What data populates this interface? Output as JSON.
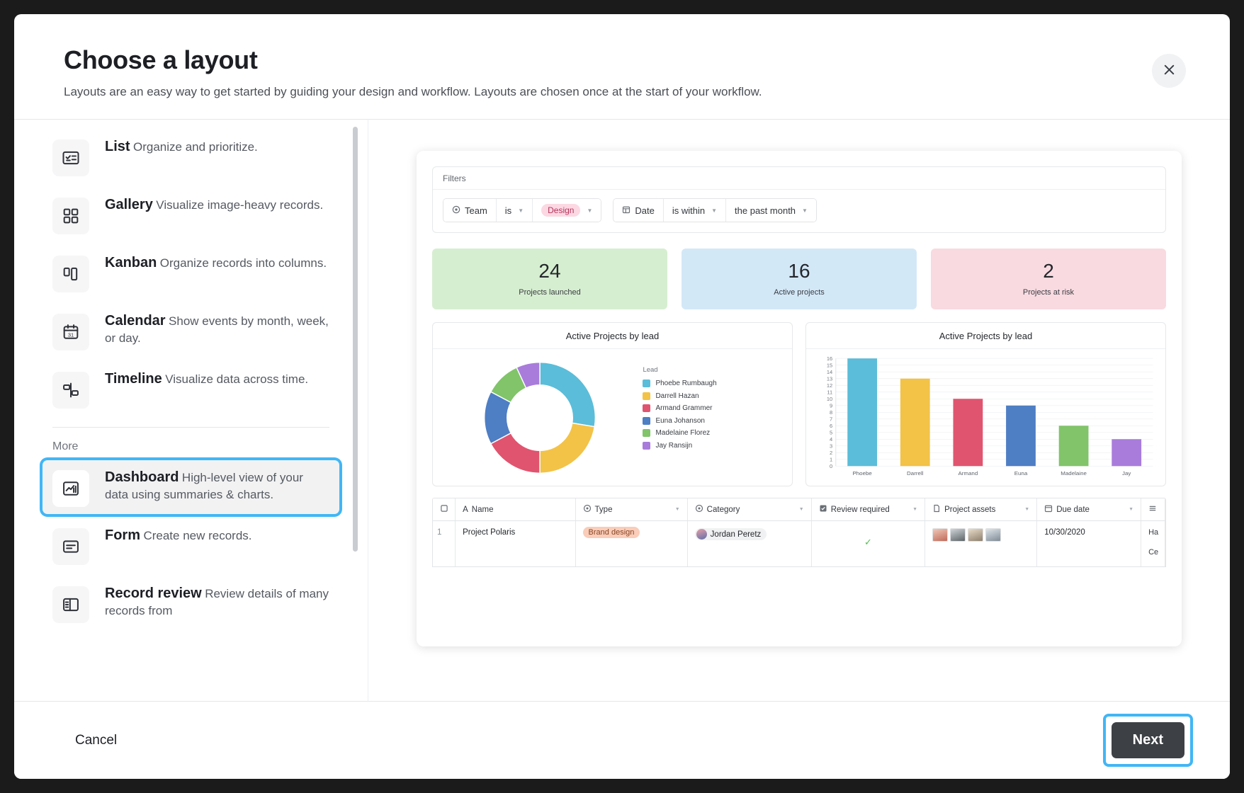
{
  "dialog": {
    "title": "Choose a layout",
    "subtitle": "Layouts are an easy way to get started by guiding your design and workflow. Layouts are chosen once at the start of your workflow.",
    "close_icon": "close-icon"
  },
  "sidebar": {
    "more_label": "More",
    "items": [
      {
        "title": "List",
        "desc": "Organize and prioritize.",
        "icon": "list-check-icon",
        "selected": false
      },
      {
        "title": "Gallery",
        "desc": "Visualize image-heavy records.",
        "icon": "grid-icon",
        "selected": false
      },
      {
        "title": "Kanban",
        "desc": "Organize records into columns.",
        "icon": "kanban-icon",
        "selected": false
      },
      {
        "title": "Calendar",
        "desc": "Show events by month, week, or day.",
        "icon": "calendar-icon",
        "selected": false
      },
      {
        "title": "Timeline",
        "desc": "Visualize data across time.",
        "icon": "timeline-icon",
        "selected": false
      }
    ],
    "more_items": [
      {
        "title": "Dashboard",
        "desc": "High-level view of your data using summaries & charts.",
        "icon": "chart-box-icon",
        "selected": true
      },
      {
        "title": "Form",
        "desc": "Create new records.",
        "icon": "form-icon",
        "selected": false
      },
      {
        "title": "Record review",
        "desc": "Review details of many records from",
        "icon": "record-review-icon",
        "selected": false
      }
    ]
  },
  "preview": {
    "filters": {
      "heading": "Filters",
      "group1": {
        "field": "Team",
        "operator": "is",
        "value": "Design"
      },
      "group2": {
        "field": "Date",
        "operator": "is within",
        "value": "the past month"
      }
    },
    "stats": [
      {
        "value": "24",
        "label": "Projects launched",
        "color": "#d6eed0"
      },
      {
        "value": "16",
        "label": "Active projects",
        "color": "#d3e8f7"
      },
      {
        "value": "2",
        "label": "Projects at risk",
        "color": "#f8dae0"
      }
    ],
    "table": {
      "columns": [
        "",
        "Name",
        "Type",
        "Category",
        "Review required",
        "Project assets",
        "Due date",
        ""
      ],
      "column_icons": [
        "checkbox-icon",
        "text-field-icon",
        "select-icon",
        "select-icon",
        "checkbox-field-icon",
        "attachment-icon",
        "date-icon",
        "menu-icon"
      ],
      "rows": [
        {
          "num": "1",
          "name": "Project Polaris",
          "type": "Brand design",
          "category": "Jordan Peretz",
          "review_required": "✓",
          "due_date": "10/30/2020",
          "overflow_line1": "Ha",
          "overflow_line2": "Ce"
        }
      ]
    }
  },
  "chart_data": [
    {
      "type": "pie",
      "title": "Active Projects by lead",
      "legend_title": "Lead",
      "legend_position": "right",
      "categories": [
        "Phoebe Rumbaugh",
        "Darrell Hazan",
        "Armand Grammer",
        "Euna Johanson",
        "Madelaine Florez",
        "Jay Ransijn"
      ],
      "values": [
        16,
        13,
        10,
        9,
        6,
        4
      ],
      "colors": [
        "#62c3dd",
        "#f5c councils"
      ]
    },
    {
      "type": "bar",
      "title": "Active Projects by lead",
      "categories": [
        "Phoebe",
        "Darrell",
        "Armand",
        "Euna",
        "Madelaine",
        "Jay"
      ],
      "values": [
        16,
        13,
        10,
        9,
        6,
        4
      ],
      "colors": [
        "#5bbdd9",
        "#f3c347",
        "#e0546f",
        "#4e7ec4",
        "#81c46a",
        "#a97cdb"
      ],
      "xlabel": "",
      "ylabel": "",
      "ylim": [
        0,
        16
      ],
      "yticks": [
        0,
        1,
        2,
        3,
        4,
        5,
        6,
        7,
        8,
        9,
        10,
        11,
        12,
        13,
        14,
        15,
        16
      ],
      "grid": true
    }
  ],
  "palette": {
    "donut_colors": [
      "#5bbdd9",
      "#f3c347",
      "#e0546f",
      "#4e7ec4",
      "#81c46a",
      "#a97cdb"
    ]
  },
  "footer": {
    "cancel_label": "Cancel",
    "next_label": "Next"
  }
}
